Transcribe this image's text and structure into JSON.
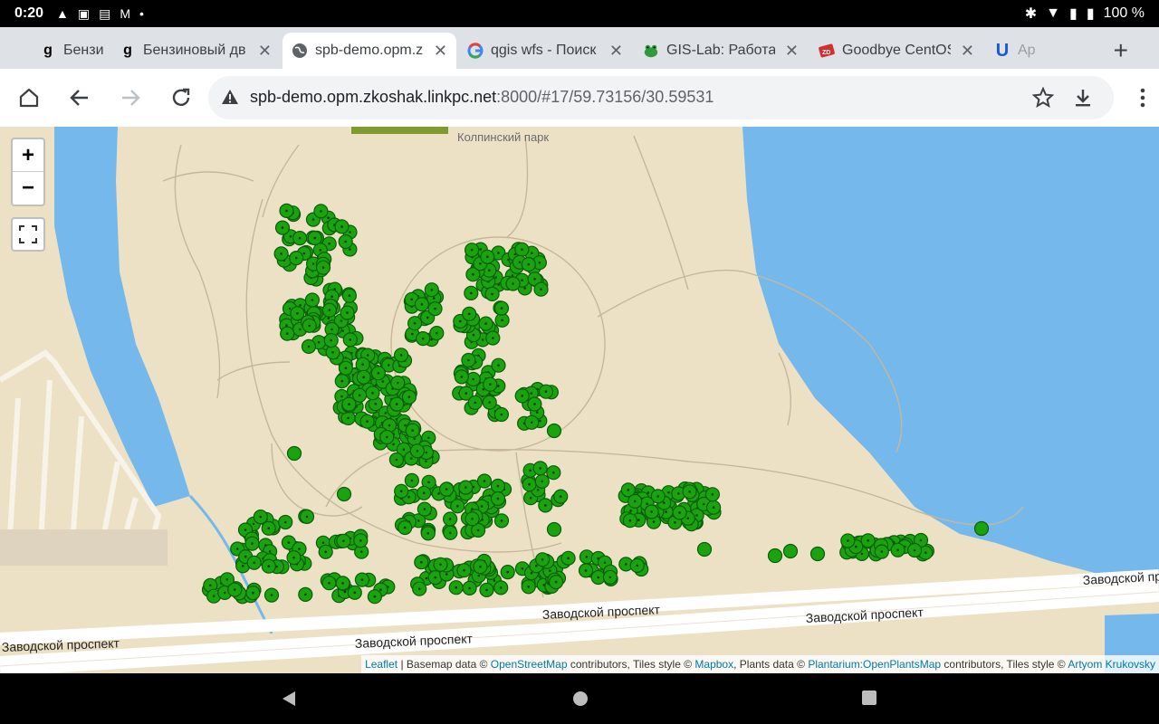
{
  "status": {
    "time": "0:20",
    "battery": "100 %"
  },
  "tabs": [
    {
      "title": "Бензи",
      "favicon": "g"
    },
    {
      "title": "Бензиновый дв",
      "favicon": "g"
    },
    {
      "title": "spb-demo.opm.z",
      "favicon": "globe"
    },
    {
      "title": "qgis wfs - Поиск",
      "favicon": "G"
    },
    {
      "title": "GIS-Lab: Работа",
      "favicon": "frog"
    },
    {
      "title": "Goodbye CentOS",
      "favicon": "zd"
    },
    {
      "title": "Ap",
      "favicon": "U"
    }
  ],
  "toolbar": {
    "url_host": "spb-demo.opm.zkoshak.linkpc.net",
    "url_rest": ":8000/#17/59.73156/30.59531"
  },
  "map": {
    "labels": {
      "park": "Колпинский парк",
      "street": "Заводской проспект"
    },
    "zoom_in": "+",
    "zoom_out": "−",
    "colors": {
      "land": "#ede1c5",
      "water": "#75b9ec",
      "plant": "#1aa30f"
    }
  },
  "attribution": {
    "leaflet": "Leaflet",
    "t1": " | Basemap data © ",
    "osm": "OpenStreetMap",
    "t2": " contributors, Tiles style © ",
    "mapbox": "Mapbox",
    "t3": ", Plants data © ",
    "plantarium": "Plantarium:OpenPlantsMap",
    "t4": " contributors, Tiles style © ",
    "author": "Artyom Krukovsky"
  }
}
